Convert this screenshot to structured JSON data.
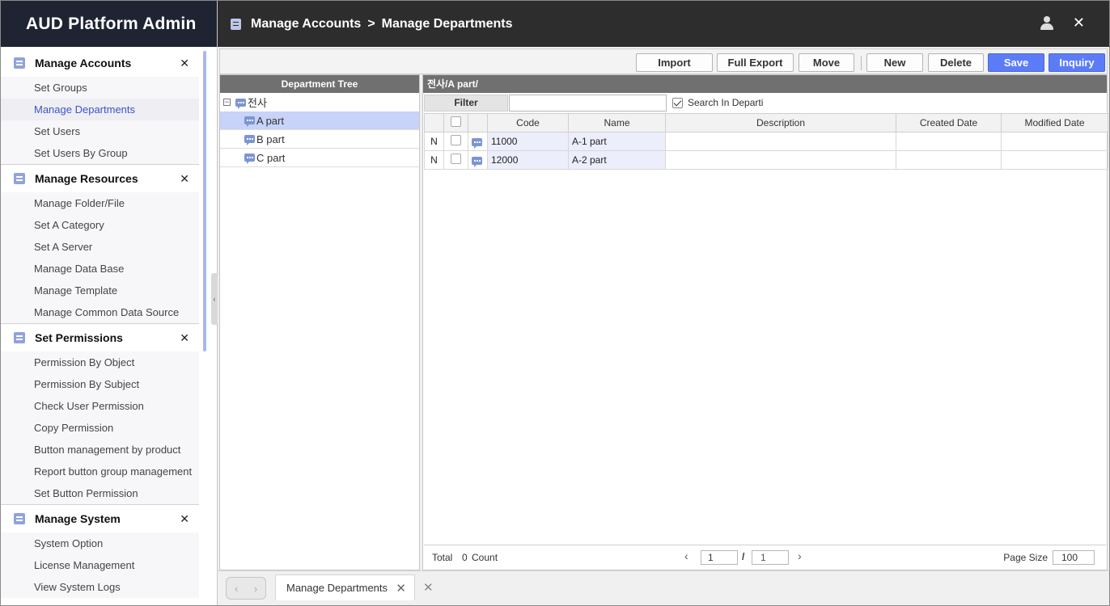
{
  "brand": "AUD Platform Admin",
  "header": {
    "crumb_parent": "Manage Accounts",
    "separator": ">",
    "crumb_current": "Manage Departments"
  },
  "sidebar": {
    "sections": [
      {
        "title": "Manage Accounts",
        "items": [
          "Set Groups",
          "Manage Departments",
          "Set Users",
          "Set Users By Group"
        ]
      },
      {
        "title": "Manage Resources",
        "items": [
          "Manage Folder/File",
          "Set A Category",
          "Set A Server",
          "Manage Data Base",
          "Manage Template",
          "Manage Common Data Source"
        ]
      },
      {
        "title": "Set Permissions",
        "items": [
          "Permission By Object",
          "Permission By Subject",
          "Check User Permission",
          "Copy Permission",
          "Button management by product",
          "Report button group management",
          "Set Button Permission"
        ]
      },
      {
        "title": "Manage System",
        "items": [
          "System Option",
          "License Management",
          "View System Logs"
        ]
      }
    ],
    "active_item": "Manage Departments"
  },
  "toolbar": {
    "import": "Import",
    "full_export": "Full Export",
    "move": "Move",
    "new": "New",
    "delete": "Delete",
    "save": "Save",
    "inquiry": "Inquiry"
  },
  "tree": {
    "header": "Department Tree",
    "root": {
      "label": "전사",
      "expander": "−"
    },
    "children": [
      "A part",
      "B part",
      "C part"
    ],
    "selected": "A part"
  },
  "grid": {
    "path": "전사/A part/",
    "filter_label": "Filter",
    "filter_value": "",
    "search_in_dept_label": "Search In Departi",
    "search_in_dept_checked": true,
    "columns": [
      "Code",
      "Name",
      "Description",
      "Created Date",
      "Modified Date"
    ],
    "rows": [
      {
        "state": "N",
        "code": "11000",
        "name": "A-1 part",
        "description": "",
        "created": "",
        "modified": ""
      },
      {
        "state": "N",
        "code": "12000",
        "name": "A-2 part",
        "description": "",
        "created": "",
        "modified": ""
      }
    ],
    "footer": {
      "total_label": "Total",
      "total_value": "0",
      "count_label": "Count",
      "page": "1",
      "page_sep": "/",
      "page_total": "1",
      "page_size_label": "Page Size",
      "page_size": "100"
    }
  },
  "tabs": [
    {
      "label": "Manage Departments"
    }
  ],
  "colors": {
    "brand_bg": "#1f2433",
    "topbar_bg": "#2d2d2d",
    "accent": "#5c7cf7",
    "active_link": "#3d55c6",
    "tree_selected": "#c7d3f8"
  }
}
